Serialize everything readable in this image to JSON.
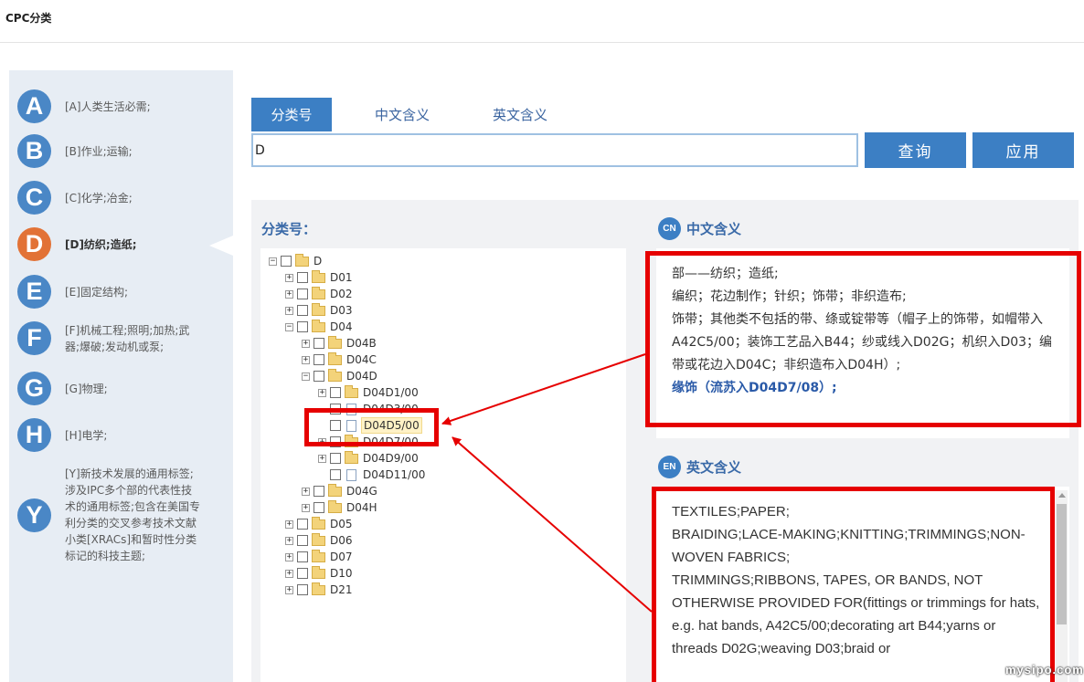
{
  "app": {
    "title": "CPC分类"
  },
  "sidebar": {
    "sections": [
      {
        "letter": "A",
        "label": "[A]人类生活必需;",
        "active": false
      },
      {
        "letter": "B",
        "label": "[B]作业;运输;",
        "active": false
      },
      {
        "letter": "C",
        "label": "[C]化学;冶金;",
        "active": false
      },
      {
        "letter": "D",
        "label": "[D]纺织;造纸;",
        "active": true
      },
      {
        "letter": "E",
        "label": "[E]固定结构;",
        "active": false
      },
      {
        "letter": "F",
        "label": "[F]机械工程;照明;加热;武器;爆破;发动机或泵;",
        "active": false
      },
      {
        "letter": "G",
        "label": "[G]物理;",
        "active": false
      },
      {
        "letter": "H",
        "label": "[H]电学;",
        "active": false
      },
      {
        "letter": "Y",
        "label": "[Y]新技术发展的通用标签;涉及IPC多个部的代表性技术的通用标签;包含在美国专利分类的交叉参考技术文献小类[XRACs]和暂时性分类标记的科技主题;",
        "active": false
      }
    ]
  },
  "tabs": [
    {
      "label": "分类号",
      "active": true
    },
    {
      "label": "中文含义",
      "active": false
    },
    {
      "label": "英文含义",
      "active": false
    }
  ],
  "search": {
    "value": "D",
    "query_label": "查询",
    "apply_label": "应用"
  },
  "tree": {
    "label": "分类号：",
    "nodes": [
      {
        "id": "D",
        "label": "D",
        "toggle": "−",
        "type": "folder"
      },
      {
        "id": "D01",
        "label": "D01",
        "toggle": "+",
        "type": "folder"
      },
      {
        "id": "D02",
        "label": "D02",
        "toggle": "+",
        "type": "folder"
      },
      {
        "id": "D03",
        "label": "D03",
        "toggle": "+",
        "type": "folder"
      },
      {
        "id": "D04",
        "label": "D04",
        "toggle": "−",
        "type": "folder"
      },
      {
        "id": "D04B",
        "label": "D04B",
        "toggle": "+",
        "type": "folder"
      },
      {
        "id": "D04C",
        "label": "D04C",
        "toggle": "+",
        "type": "folder"
      },
      {
        "id": "D04D",
        "label": "D04D",
        "toggle": "−",
        "type": "folder"
      },
      {
        "id": "D04D1-00",
        "label": "D04D1/00",
        "toggle": "+",
        "type": "folder"
      },
      {
        "id": "D04D3-00",
        "label": "D04D3/00",
        "toggle": "",
        "type": "doc"
      },
      {
        "id": "D04D5-00",
        "label": "D04D5/00",
        "toggle": "",
        "type": "doc",
        "selected": true
      },
      {
        "id": "D04D7-00",
        "label": "D04D7/00",
        "toggle": "+",
        "type": "folder"
      },
      {
        "id": "D04D9-00",
        "label": "D04D9/00",
        "toggle": "+",
        "type": "folder"
      },
      {
        "id": "D04D11-00",
        "label": "D04D11/00",
        "toggle": "",
        "type": "doc"
      },
      {
        "id": "D04G",
        "label": "D04G",
        "toggle": "+",
        "type": "folder"
      },
      {
        "id": "D04H",
        "label": "D04H",
        "toggle": "+",
        "type": "folder"
      },
      {
        "id": "D05",
        "label": "D05",
        "toggle": "+",
        "type": "folder"
      },
      {
        "id": "D06",
        "label": "D06",
        "toggle": "+",
        "type": "folder"
      },
      {
        "id": "D07",
        "label": "D07",
        "toggle": "+",
        "type": "folder"
      },
      {
        "id": "D10",
        "label": "D10",
        "toggle": "+",
        "type": "folder"
      },
      {
        "id": "D21",
        "label": "D21",
        "toggle": "+",
        "type": "folder"
      }
    ]
  },
  "chinese_meaning": {
    "badge": "CN",
    "title": "中文含义",
    "lines": [
      "部——纺织；造纸;",
      "编织；花边制作；针织；饰带；非织造布;",
      "饰带；其他类不包括的带、绦或锭带等（帽子上的饰带，如帽带入A42C5/00；装饰工艺品入B44；纱或线入D02G；机织入D03；编带或花边入D04C；非织造布入D04H）;"
    ],
    "highlight": "缘饰（流苏入D04D7/08）;"
  },
  "english_meaning": {
    "badge": "EN",
    "title": "英文含义",
    "lines": [
      "TEXTILES;PAPER;",
      "BRAIDING;LACE-MAKING;KNITTING;TRIMMINGS;NON-WOVEN FABRICS;",
      "TRIMMINGS;RIBBONS, TAPES, OR BANDS, NOT OTHERWISE PROVIDED FOR(fittings or trimmings for hats, e.g. hat bands, A42C5/00;decorating art B44;yarns or threads D02G;weaving D03;braid or"
    ]
  },
  "watermark": {
    "text": "mysipo.com"
  },
  "colors": {
    "accent": "#3c7fc4",
    "active_section": "#e27236",
    "annotation": "#e60000"
  }
}
